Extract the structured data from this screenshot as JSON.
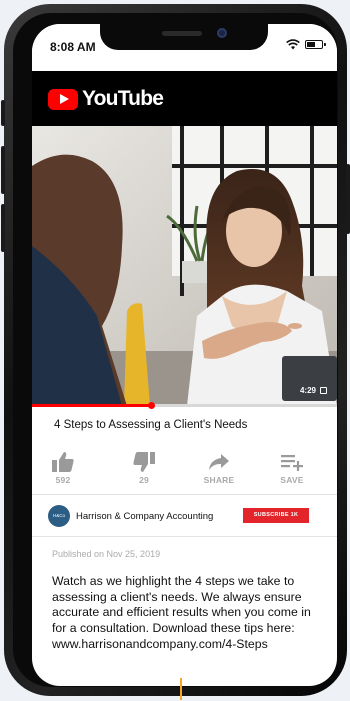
{
  "status_bar": {
    "time": "8:08 AM",
    "battery_level": 0.65
  },
  "header": {
    "logo_text": "YouTube",
    "logo_color": "#ff0000"
  },
  "video": {
    "duration": "4:29",
    "progress_fraction": 0.39
  },
  "title": "4 Steps to Assessing a Client's Needs",
  "actions": {
    "like_count": "592",
    "dislike_count": "29",
    "share_label": "SHARE",
    "save_label": "SAVE"
  },
  "channel": {
    "avatar_text": "H&Co",
    "name": "Harrison & Company Accounting",
    "subscribe_label": "SUBSCRIBE 1K"
  },
  "published": "Published on Nov 25, 2019",
  "description": "Watch as we highlight the 4 steps we take to assessing a client's needs. We always ensure accurate and efficient results when you come in for a consultation. Download these tips here: www.harrisonandcompany.com/4-Steps",
  "colors": {
    "accent": "#ff0000",
    "subscribe": "#e3242b",
    "meta_gray": "#aaaaaa"
  }
}
